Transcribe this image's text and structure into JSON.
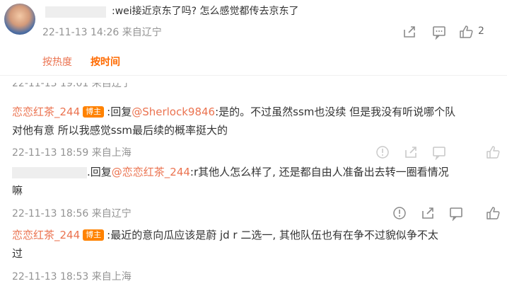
{
  "top_comment": {
    "text": ":wei接近京东了吗? 怎么感觉都传去京东了",
    "meta": "22-11-13 14:26 来自辽宁",
    "like_count": "2"
  },
  "tabs": [
    {
      "label": "按热度",
      "active": false
    },
    {
      "label": "按时间",
      "active": true
    }
  ],
  "partial_meta": "22-11-13 19:01 来自辽宁",
  "replies": [
    {
      "username": "恋恋红茶_244",
      "badge": "博主",
      "prefix": ":回复",
      "mention": "@Sherlock9846",
      "line1": ":是的。不过虽然ssm也没续 但是我没有听说哪个队",
      "line2": "对他有意 所以我感觉ssm最后续的概率挺大的",
      "meta": "22-11-13 18:59 来自上海"
    },
    {
      "prefix": ".回复",
      "mention": "@恋恋红茶_244",
      "line1": ":r其他人怎么样了, 还是都自由人准备出去转一圈看情况",
      "line2": "嘛",
      "meta": "22-11-13 18:56 来自辽宁"
    },
    {
      "username": "恋恋红茶_244",
      "badge": "博主",
      "line1": ":最近的意向瓜应该是蔚 jd r 二选一, 其他队伍也有在争不过貌似争不太",
      "line2": "过",
      "meta": "22-11-13 18:53 来自上海"
    }
  ],
  "colors": {
    "accent": "#eb7350",
    "tab_active": "#ff8200",
    "badge": "#ff8200",
    "meta": "#939393"
  }
}
